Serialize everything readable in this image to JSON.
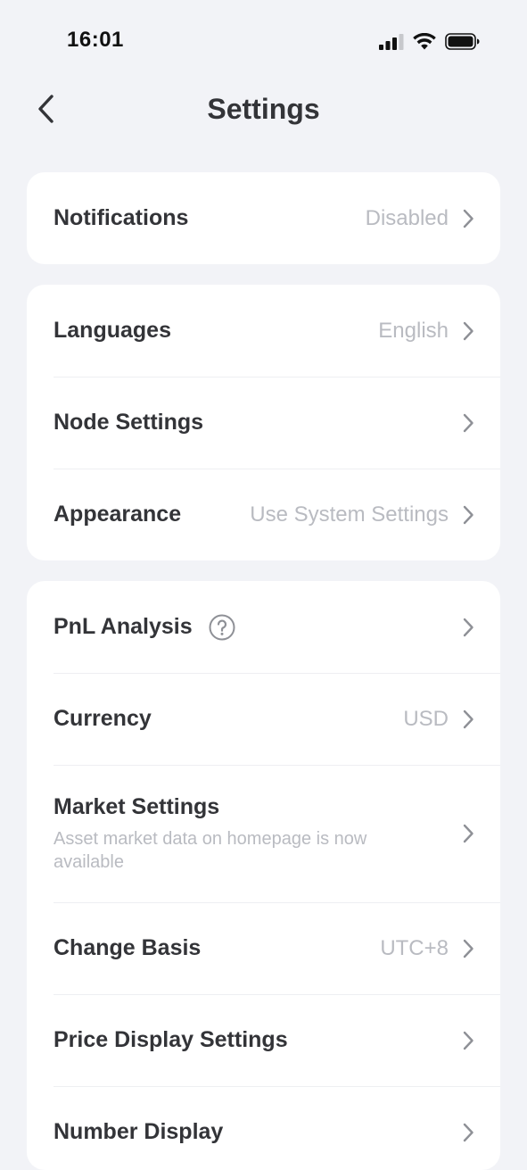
{
  "status_bar": {
    "time": "16:01"
  },
  "header": {
    "title": "Settings"
  },
  "groups": [
    {
      "items": [
        {
          "label": "Notifications",
          "value": "Disabled"
        }
      ]
    },
    {
      "items": [
        {
          "label": "Languages",
          "value": "English"
        },
        {
          "label": "Node Settings",
          "value": ""
        },
        {
          "label": "Appearance",
          "value": "Use System Settings"
        }
      ]
    },
    {
      "items": [
        {
          "label": "PnL Analysis",
          "value": "",
          "icon": "help-circle-icon"
        },
        {
          "label": "Currency",
          "value": "USD"
        },
        {
          "label": "Market Settings",
          "value": "",
          "subtitle": "Asset market data on homepage is now available"
        },
        {
          "label": "Change Basis",
          "value": "UTC+8"
        },
        {
          "label": "Price Display Settings",
          "value": ""
        },
        {
          "label": "Number Display",
          "value": ""
        }
      ]
    }
  ],
  "colors": {
    "background": "#f2f3f7",
    "card": "#ffffff",
    "text_primary": "#333438",
    "text_secondary": "#b9bbc1",
    "chevron": "#8e9096"
  }
}
